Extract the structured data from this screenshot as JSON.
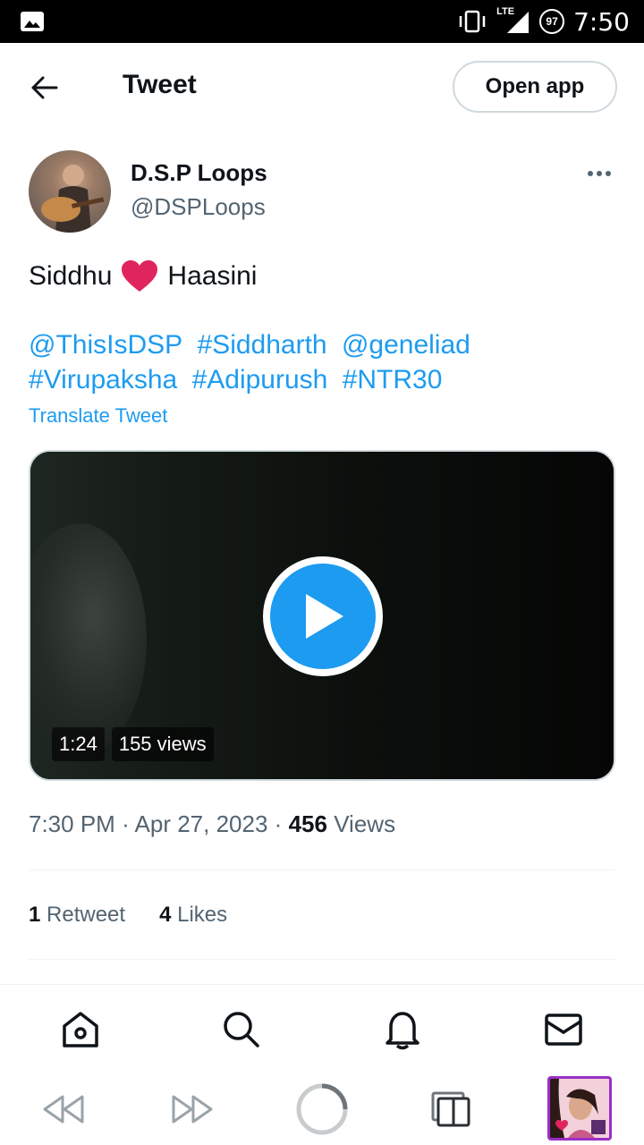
{
  "status_bar": {
    "time": "7:50",
    "network": "LTE",
    "battery": "97"
  },
  "header": {
    "title": "Tweet",
    "open_app": "Open app"
  },
  "author": {
    "name": "D.S.P Loops",
    "handle": "@DSPLoops"
  },
  "tweet": {
    "text_before": "Siddhu",
    "text_after": "Haasini",
    "links": [
      "@ThisIsDSP",
      "#Siddharth",
      "@geneliad",
      "#Virupaksha",
      "#Adipurush",
      "#NTR30"
    ],
    "translate": "Translate Tweet"
  },
  "video": {
    "duration": "1:24",
    "views": "155 views"
  },
  "meta": {
    "time": "7:30 PM",
    "separator": "·",
    "date": "Apr 27, 2023",
    "views_count": "456",
    "views_label": "Views"
  },
  "stats": {
    "retweets_count": "1",
    "retweets_label": "Retweet",
    "likes_count": "4",
    "likes_label": "Likes"
  },
  "nav": [
    "home-icon",
    "search-icon",
    "bell-icon",
    "mail-icon"
  ],
  "browser": [
    "rewind-icon",
    "fast-forward-icon",
    "loading-spinner",
    "tabs-icon",
    "profile-thumbnail"
  ],
  "colors": {
    "accent": "#1d9bf0",
    "heart": "#e0245e",
    "text": "#0f1419",
    "muted": "#536471",
    "thumb_border": "#9b2fc6"
  }
}
